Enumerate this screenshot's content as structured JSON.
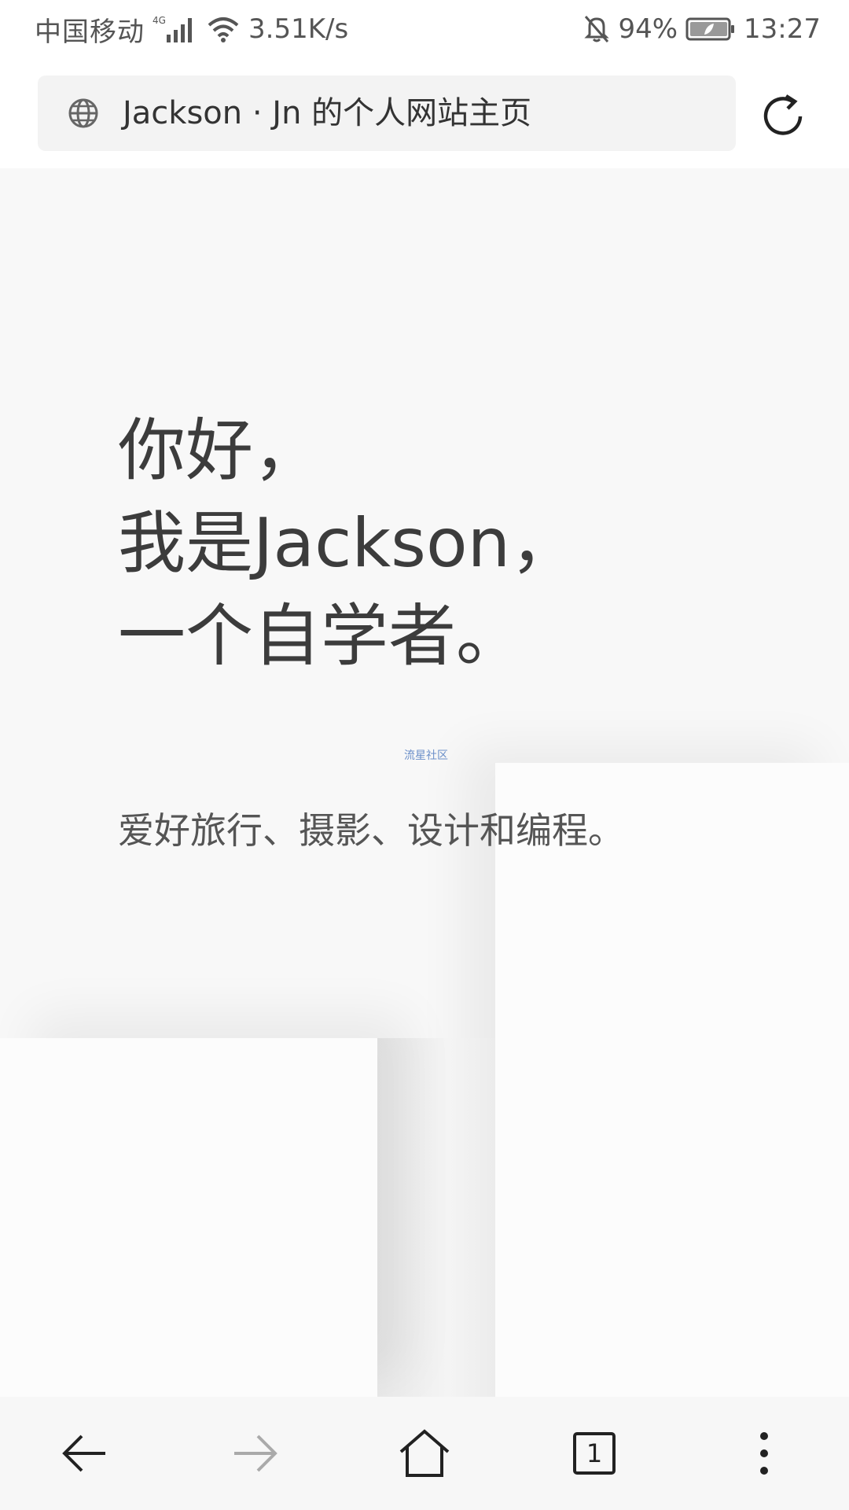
{
  "status_bar": {
    "carrier": "中国移动",
    "network_type": "4G",
    "net_speed": "3.51K/s",
    "battery": "94%",
    "time": "13:27",
    "icons": [
      "signal-icon",
      "wifi-icon",
      "mute-bell-icon",
      "battery-icon"
    ]
  },
  "address_bar": {
    "title": "Jackson · Jn 的个人网站主页",
    "icons": [
      "globe-icon",
      "refresh-icon"
    ]
  },
  "content": {
    "hero_lines": [
      "你好，",
      "我是Jackson，",
      "一个自学者。"
    ],
    "watermark": "流星社区",
    "subtitle": "爱好旅行、摄影、设计和编程。"
  },
  "bottom_nav": {
    "tab_count": "1",
    "icons": [
      "back-icon",
      "forward-icon",
      "home-icon",
      "tabs-icon",
      "more-icon"
    ]
  },
  "colors": {
    "page_background": "#f8f8f8",
    "address_background": "#f3f3f3",
    "hero_text": "#3c3c3c",
    "watermark": "#6b8fc9"
  }
}
